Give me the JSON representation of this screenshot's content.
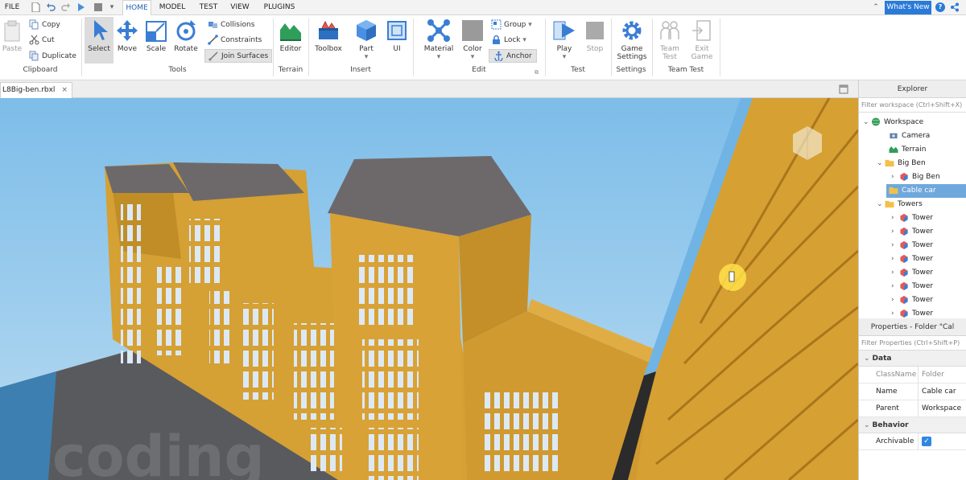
{
  "menubar": {
    "file": "FILE",
    "tabs": [
      "HOME",
      "MODEL",
      "TEST",
      "VIEW",
      "PLUGINS"
    ],
    "whats_new": "What's New"
  },
  "ribbon": {
    "clipboard": {
      "paste": "Paste",
      "copy": "Copy",
      "cut": "Cut",
      "duplicate": "Duplicate",
      "group": "Clipboard"
    },
    "tools": {
      "select": "Select",
      "move": "Move",
      "scale": "Scale",
      "rotate": "Rotate",
      "collisions": "Collisions",
      "constraints": "Constraints",
      "join_surfaces": "Join Surfaces",
      "group": "Tools"
    },
    "terrain": {
      "editor": "Editor",
      "group": "Terrain"
    },
    "insert": {
      "toolbox": "Toolbox",
      "part": "Part",
      "ui": "UI",
      "group": "Insert"
    },
    "edit": {
      "material": "Material",
      "color": "Color",
      "group_btn": "Group",
      "lock": "Lock",
      "anchor": "Anchor",
      "group": "Edit"
    },
    "test": {
      "play": "Play",
      "stop": "Stop",
      "group": "Test"
    },
    "settings": {
      "game_line1": "Game",
      "game_line2": "Settings",
      "group": "Settings"
    },
    "team_test": {
      "team_line1": "Team",
      "team_line2": "Test",
      "exit_line1": "Exit",
      "exit_line2": "Game",
      "group": "Team Test"
    }
  },
  "document": {
    "tab_title": "L8Big-ben.rbxl",
    "close_glyph": "×"
  },
  "viewport": {
    "watermark": "coding"
  },
  "explorer": {
    "title": "Explorer",
    "filter_placeholder": "Filter workspace (Ctrl+Shift+X)",
    "items": [
      {
        "label": "Workspace",
        "icon": "globe-icon"
      },
      {
        "label": "Camera",
        "icon": "camera-icon"
      },
      {
        "label": "Terrain",
        "icon": "terrain-icon"
      },
      {
        "label": "Big Ben",
        "icon": "folder-icon"
      },
      {
        "label": "Big Ben",
        "icon": "model-icon"
      },
      {
        "label": "Cable car",
        "icon": "folder-icon"
      },
      {
        "label": "Towers",
        "icon": "folder-icon"
      },
      {
        "label": "Tower",
        "icon": "model-icon"
      },
      {
        "label": "Tower",
        "icon": "model-icon"
      },
      {
        "label": "Tower",
        "icon": "model-icon"
      },
      {
        "label": "Tower",
        "icon": "model-icon"
      },
      {
        "label": "Tower",
        "icon": "model-icon"
      },
      {
        "label": "Tower",
        "icon": "model-icon"
      },
      {
        "label": "Tower",
        "icon": "model-icon"
      },
      {
        "label": "Tower",
        "icon": "model-icon"
      }
    ]
  },
  "properties": {
    "title": "Properties - Folder \"Cal",
    "filter_placeholder": "Filter Properties (Ctrl+Shift+P)",
    "data_category": "Data",
    "behavior_category": "Behavior",
    "rows": [
      {
        "name": "ClassName",
        "value": "Folder"
      },
      {
        "name": "Name",
        "value": "Cable car"
      },
      {
        "name": "Parent",
        "value": "Workspace"
      }
    ],
    "archivable": {
      "name": "Archivable",
      "checked": true
    }
  },
  "colors": {
    "accent": "#2a7ad9",
    "selection": "#6fa8dc",
    "building": "#d9a032",
    "roof": "#6f6a6b",
    "sky": "#8cc4ea"
  }
}
